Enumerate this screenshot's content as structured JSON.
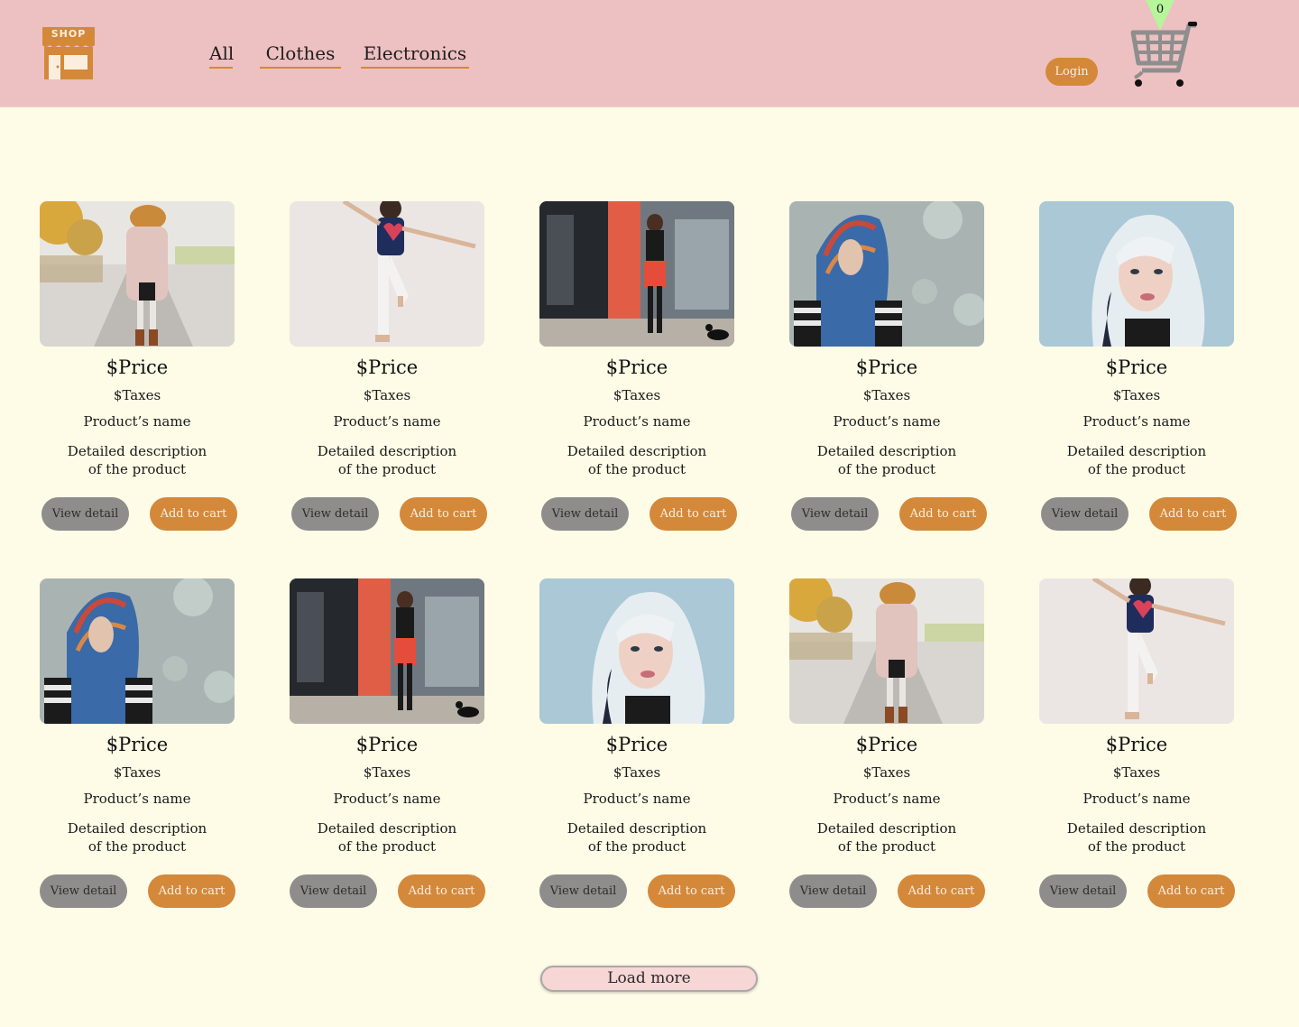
{
  "header": {
    "logo_text": "SHOP",
    "nav": [
      {
        "label": "All"
      },
      {
        "label": "Clothes"
      },
      {
        "label": "Electronics"
      }
    ],
    "login_label": "Login",
    "cart_count": "0"
  },
  "products": [
    {
      "photo": "woman-pink-coat-street",
      "price": "$Price",
      "taxes": "$Taxes",
      "name": "Product’s name",
      "desc_line1": "Detailed description",
      "desc_line2": "of the product",
      "view_label": "View detail",
      "add_label": "Add to cart"
    },
    {
      "photo": "woman-jumping-navy-tee",
      "price": "$Price",
      "taxes": "$Taxes",
      "name": "Product’s name",
      "desc_line1": "Detailed description",
      "desc_line2": "of the product",
      "view_label": "View detail",
      "add_label": "Add to cart"
    },
    {
      "photo": "woman-red-skirt-storefront",
      "price": "$Price",
      "taxes": "$Taxes",
      "name": "Product’s name",
      "desc_line1": "Detailed description",
      "desc_line2": "of the product",
      "view_label": "View detail",
      "add_label": "Add to cart"
    },
    {
      "photo": "woman-colorful-scarf",
      "price": "$Price",
      "taxes": "$Taxes",
      "name": "Product’s name",
      "desc_line1": "Detailed description",
      "desc_line2": "of the product",
      "view_label": "View detail",
      "add_label": "Add to cart"
    },
    {
      "photo": "woman-white-hair-portrait",
      "price": "$Price",
      "taxes": "$Taxes",
      "name": "Product’s name",
      "desc_line1": "Detailed description",
      "desc_line2": "of the product",
      "view_label": "View detail",
      "add_label": "Add to cart"
    },
    {
      "photo": "woman-colorful-scarf",
      "price": "$Price",
      "taxes": "$Taxes",
      "name": "Product’s name",
      "desc_line1": "Detailed description",
      "desc_line2": "of the product",
      "view_label": "View detail",
      "add_label": "Add to cart"
    },
    {
      "photo": "woman-red-skirt-storefront",
      "price": "$Price",
      "taxes": "$Taxes",
      "name": "Product’s name",
      "desc_line1": "Detailed description",
      "desc_line2": "of the product",
      "view_label": "View detail",
      "add_label": "Add to cart"
    },
    {
      "photo": "woman-white-hair-portrait",
      "price": "$Price",
      "taxes": "$Taxes",
      "name": "Product’s name",
      "desc_line1": "Detailed description",
      "desc_line2": "of the product",
      "view_label": "View detail",
      "add_label": "Add to cart"
    },
    {
      "photo": "woman-pink-coat-street",
      "price": "$Price",
      "taxes": "$Taxes",
      "name": "Product’s name",
      "desc_line1": "Detailed description",
      "desc_line2": "of the product",
      "view_label": "View detail",
      "add_label": "Add to cart"
    },
    {
      "photo": "woman-jumping-navy-tee",
      "price": "$Price",
      "taxes": "$Taxes",
      "name": "Product’s name",
      "desc_line1": "Detailed description",
      "desc_line2": "of the product",
      "view_label": "View detail",
      "add_label": "Add to cart"
    }
  ],
  "load_more_label": "Load more",
  "colors": {
    "header_bg": "#edc0c1",
    "page_bg": "#fefbe6",
    "accent": "#d4883a",
    "view_button": "#8f8d8c",
    "load_more_bg": "#f7d6d6",
    "cart_badge": "#b6f59a"
  }
}
